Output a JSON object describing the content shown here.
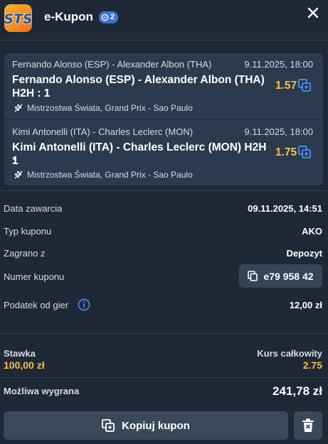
{
  "header": {
    "title": "e-Kupon",
    "bet_count": "2"
  },
  "bets": [
    {
      "event_small": "Fernando Alonso (ESP) - Alexander Albon (THA)",
      "date": "9.11.2025, 18:00",
      "name_line1": "Fernando Alonso (ESP) - Alexander Albon (THA)",
      "name_line2": "H2H : 1",
      "odds": "1.57",
      "league": "Mistrzostwa Świata, Grand Prix - Sao Paulo"
    },
    {
      "event_small": "Kimi Antonelli (ITA) - Charles Leclerc (MON)",
      "date": "9.11.2025, 18:00",
      "name_line1": "Kimi Antonelli (ITA) - Charles Leclerc (MON) H2H :",
      "name_line2": "1",
      "odds": "1.75",
      "league": "Mistrzostwa Świata, Grand Prix - Sao Paulo"
    }
  ],
  "details": {
    "date_label": "Data zawarcia",
    "date_value": "09.11.2025, 14:51",
    "type_label": "Typ kuponu",
    "type_value": "AKO",
    "played_label": "Zagrano z",
    "played_value": "Depozyt",
    "number_label": "Numer kuponu",
    "number_value": "e79 958 42",
    "tax_label": "Podatek od gier",
    "tax_value": "12,00 zł"
  },
  "summary": {
    "stake_label": "Stawka",
    "stake_value": "100,00 zł",
    "odds_label": "Kurs całkowity",
    "odds_value": "2.75",
    "win_label": "Możliwa wygrana",
    "win_value": "241,78 zł"
  },
  "actions": {
    "copy_label": "Kopiuj kupon"
  },
  "colors": {
    "background": "#1e2836",
    "card": "#2c3a4d",
    "accent_yellow": "#f5c242",
    "badge_blue": "#3f74d6",
    "button": "#3a4859"
  }
}
